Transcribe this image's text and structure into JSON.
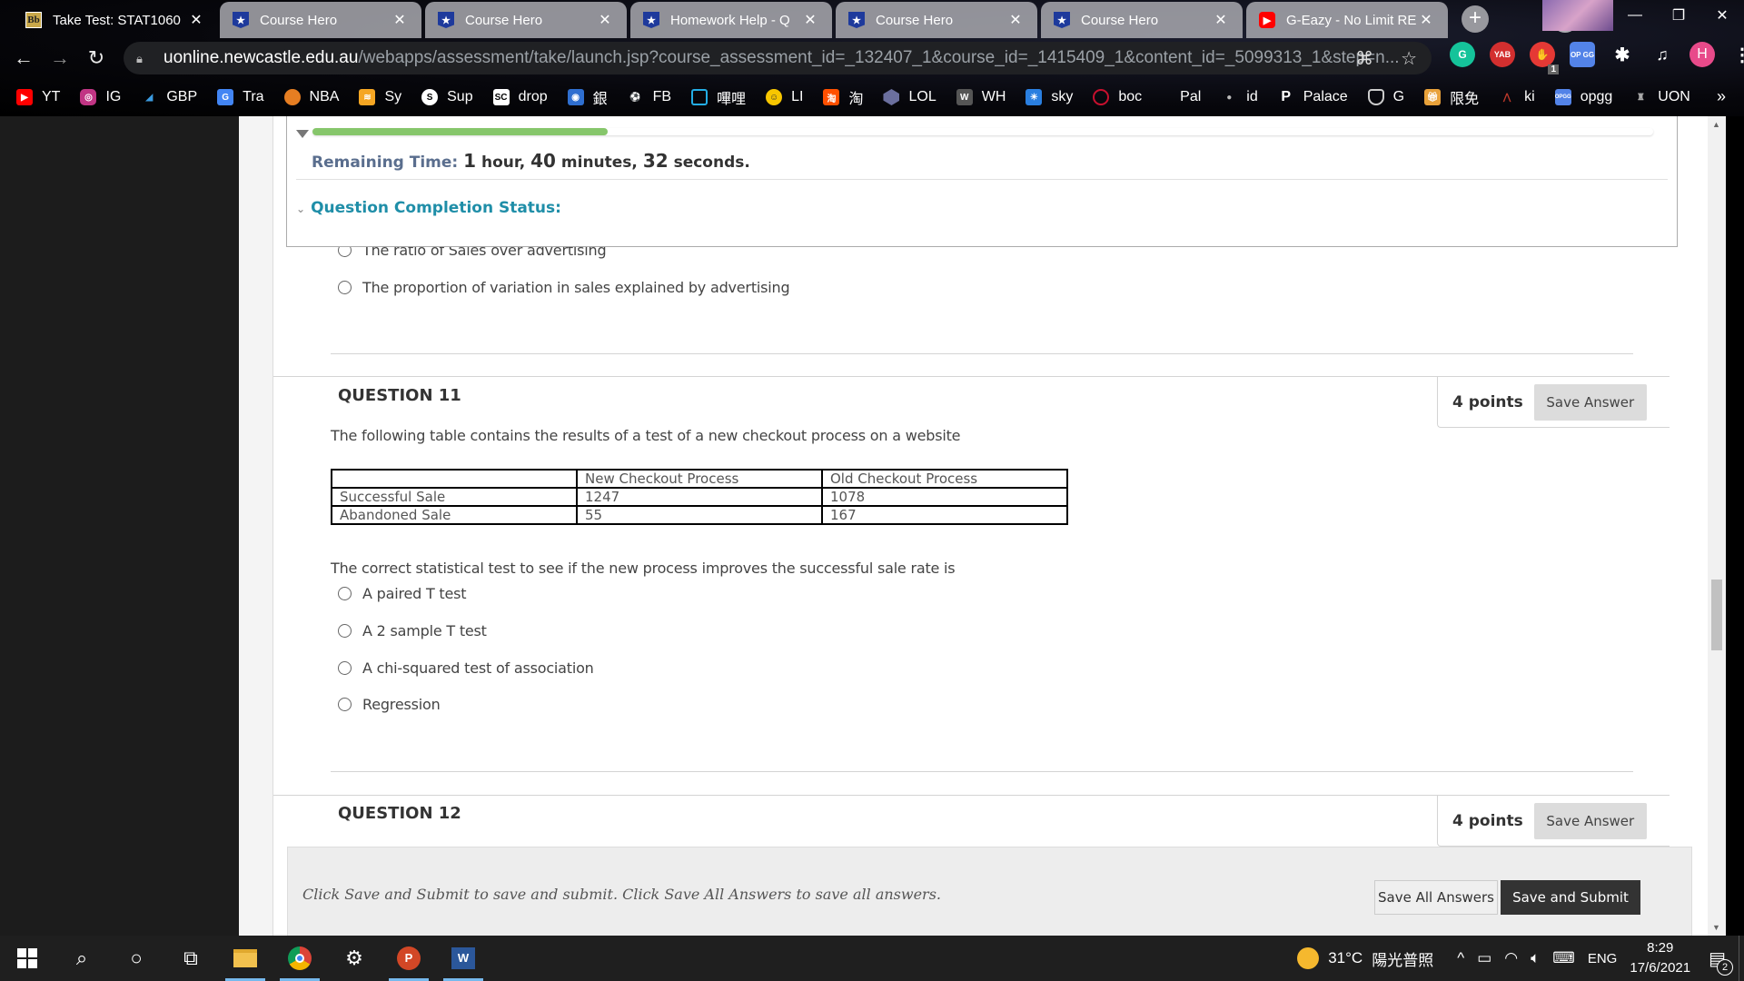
{
  "browser": {
    "tabs": [
      {
        "title": "Take Test: STAT1060",
        "favicon": "blackboard-icon",
        "active": true
      },
      {
        "title": "Course Hero",
        "favicon": "course-hero-icon",
        "active": false
      },
      {
        "title": "Course Hero",
        "favicon": "course-hero-icon",
        "active": false
      },
      {
        "title": "Homework Help - Q",
        "favicon": "course-hero-icon",
        "active": false
      },
      {
        "title": "Course Hero",
        "favicon": "course-hero-icon",
        "active": false
      },
      {
        "title": "Course Hero",
        "favicon": "course-hero-icon",
        "active": false
      },
      {
        "title": "G-Eazy - No Limit RE",
        "favicon": "youtube-icon",
        "active": false
      }
    ],
    "new_tab_label": "+",
    "url_host": "uonline.newcastle.edu.au",
    "url_path": "/webapps/assessment/take/launch.jsp?course_assessment_id=_132407_1&course_id=_1415409_1&content_id=_5099313_1&step=n...",
    "profile_initial": "H",
    "extensions": [
      {
        "name": "grammarly",
        "label": "G",
        "color": "#15c39a"
      },
      {
        "name": "yab",
        "label": "YAB",
        "color": "#d32f2f"
      },
      {
        "name": "adblock",
        "label": "✋",
        "color": "#e53935",
        "badge": "1"
      },
      {
        "name": "opgg",
        "label": "OP GG",
        "color": "#5383e8"
      }
    ],
    "bookmarks": [
      {
        "label": "YT",
        "color": "#ff0000"
      },
      {
        "label": "IG",
        "color": "#c13584"
      },
      {
        "label": "GBP",
        "color": "#3b6fb6"
      },
      {
        "label": "Tra",
        "color": "#4285f4"
      },
      {
        "label": "NBA",
        "color": "#e67e22"
      },
      {
        "label": "Sy",
        "color": "#f5a623"
      },
      {
        "label": "Sup",
        "color": "#333333"
      },
      {
        "label": "drop",
        "color": "#ffffff"
      },
      {
        "label": "銀",
        "color": "#2f6fd0"
      },
      {
        "label": "FB",
        "color": "#3a9a3a"
      },
      {
        "label": "嗶哩",
        "color": "#23ade5"
      },
      {
        "label": "LI",
        "color": "#f7c600"
      },
      {
        "label": "淘",
        "color": "#ff5000"
      },
      {
        "label": "LOL",
        "color": "#6b6f9e"
      },
      {
        "label": "WH",
        "color": "#555555"
      },
      {
        "label": "sky",
        "color": "#2a7fe0"
      },
      {
        "label": "boc",
        "color": "#c8102e"
      },
      {
        "label": "Pal",
        "color": "transparent"
      },
      {
        "label": "id",
        "color": "#888888"
      },
      {
        "label": "Palace",
        "color": "transparent"
      },
      {
        "label": "G",
        "color": "#444444"
      },
      {
        "label": "限免",
        "color": "#e8a13a"
      },
      {
        "label": "ki",
        "color": "#c0392b"
      },
      {
        "label": "opgg",
        "color": "#5383e8"
      },
      {
        "label": "UON",
        "color": "#777777"
      }
    ],
    "bookmarks_more": "»"
  },
  "test": {
    "progress_fraction": 0.22,
    "remaining_label": "Remaining Time:",
    "remaining_hours": "1",
    "remaining_hours_unit": "hour,",
    "remaining_minutes": "40",
    "remaining_minutes_unit": "minutes,",
    "remaining_seconds": "32",
    "remaining_seconds_unit": "seconds.",
    "completion_status_label": "Question Completion Status:"
  },
  "previous_question": {
    "options": [
      "The ratio of Sales over advertising",
      "The proportion of variation in sales explained by advertising"
    ]
  },
  "question_11": {
    "title": "QUESTION 11",
    "points": "4 points",
    "save_label": "Save Answer",
    "intro": "The following table contains the results of a test of a new checkout process on a website",
    "table": {
      "headers": [
        "",
        "New Checkout Process",
        "Old Checkout Process"
      ],
      "rows": [
        [
          "Successful Sale",
          "1247",
          "1078"
        ],
        [
          "Abandoned Sale",
          "55",
          "167"
        ]
      ]
    },
    "prompt": "The correct statistical test to see if the new process improves the successful sale rate is",
    "options": [
      "A paired T test",
      "A 2 sample T test",
      "A chi-squared test of association",
      "Regression"
    ]
  },
  "question_12": {
    "title": "QUESTION 12",
    "points": "4 points",
    "save_label": "Save Answer"
  },
  "footer": {
    "instructions": "Click Save and Submit to save and submit. Click Save All Answers to save all answers.",
    "save_all_label": "Save All Answers",
    "save_submit_label": "Save and Submit"
  },
  "taskbar": {
    "weather_temp": "31°C",
    "weather_desc": "陽光普照",
    "language": "ENG",
    "time": "8:29",
    "date": "17/6/2021",
    "notification_count": "2"
  }
}
